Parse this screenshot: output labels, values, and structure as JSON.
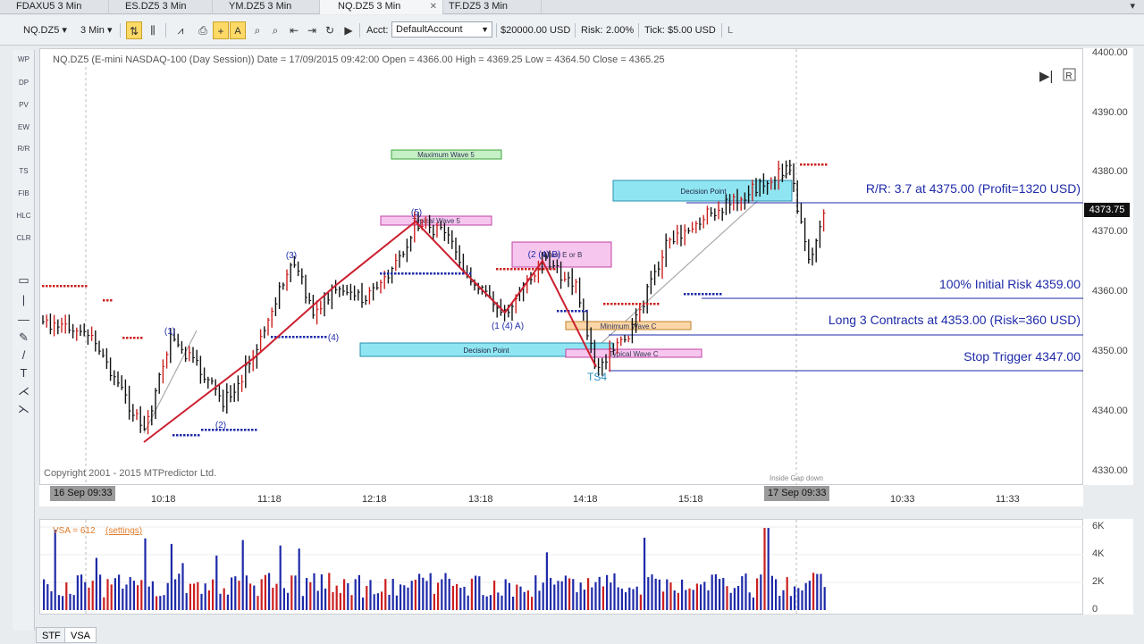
{
  "tabs": [
    {
      "label": "FDAXU5 3 Min",
      "active": false
    },
    {
      "label": "ES.DZ5 3 Min",
      "active": false
    },
    {
      "label": "YM.DZ5 3 Min",
      "active": false
    },
    {
      "label": "NQ.DZ5 3 Min",
      "active": true
    },
    {
      "label": "TF.DZ5 3 Min",
      "active": false
    }
  ],
  "toolbar": {
    "instrument": "NQ.DZ5",
    "interval": "3 Min",
    "acct_label": "Acct:",
    "account": "DefaultAccount",
    "balance": "$20000.00 USD",
    "risk_label": "Risk:",
    "risk": "2.00%",
    "tick_label": "Tick:",
    "tick": "$5.00 USD",
    "tick_suffix": "L"
  },
  "left_tools": [
    "WP",
    "DP",
    "PV",
    "EW",
    "R/R",
    "TS",
    "FIB",
    "HLC",
    "CLR"
  ],
  "chart": {
    "header": "NQ.DZ5 (E-mini NASDAQ-100 (Day Session)) Date = 17/09/2015 09:42:00 Open = 4366.00 High = 4369.25 Low = 4364.50 Close = 4365.25",
    "copyright": "Copyright 2001 - 2015 MTPredictor Ltd.",
    "gap_label": "Inside Gap down",
    "price_label": "4373.75",
    "annotations": {
      "rr": "R/R: 3.7 at 4375.00 (Profit=1320 USD)",
      "initial_risk": "100% Initial Risk 4359.00",
      "long": "Long 3 Contracts at 4353.00 (Risk=360 USD)",
      "stop": "Stop Trigger 4347.00"
    },
    "boxes": {
      "max_wave5": "Maximum Wave 5",
      "typical_wave5": "Typical Wave 5",
      "wave_e_b": "Wave E or B",
      "decision_point_top": "Decision Point",
      "decision_point_mid": "Decision Point",
      "min_wave_c": "Minimum Wave C",
      "typical_wave_c": "Typical Wave C"
    },
    "wave_labels": {
      "w1": "(1)",
      "w2": "(2)",
      "w3": "(3)",
      "w4": "(4)",
      "w5": "(5)",
      "wa": "(1 (4) A)",
      "wb": "(2 (4) B)",
      "ts4": "TS4"
    },
    "start_date_badge": "16 Sep 09:33",
    "end_date_badge": "17 Sep 09:33"
  },
  "y_ticks": [
    "4400.00",
    "4390.00",
    "4380.00",
    "4370.00",
    "4360.00",
    "4350.00",
    "4340.00",
    "4330.00"
  ],
  "x_ticks": [
    "10:18",
    "11:18",
    "12:18",
    "13:18",
    "14:18",
    "15:18",
    "10:33",
    "11:33"
  ],
  "volume": {
    "label": "VSA = 612",
    "settings": "(settings)",
    "ticks": [
      "6K",
      "4K",
      "2K",
      "0"
    ]
  },
  "bottom_tabs": [
    "STF",
    "VSA"
  ],
  "colors": {
    "bull": "#cc1f1f",
    "bear": "#111111",
    "wave": "#cc1f2f",
    "blue": "#1e2aa8",
    "cyan": "#8fe6f2",
    "pink": "#f6c6ee",
    "green": "#c6f0c6"
  }
}
